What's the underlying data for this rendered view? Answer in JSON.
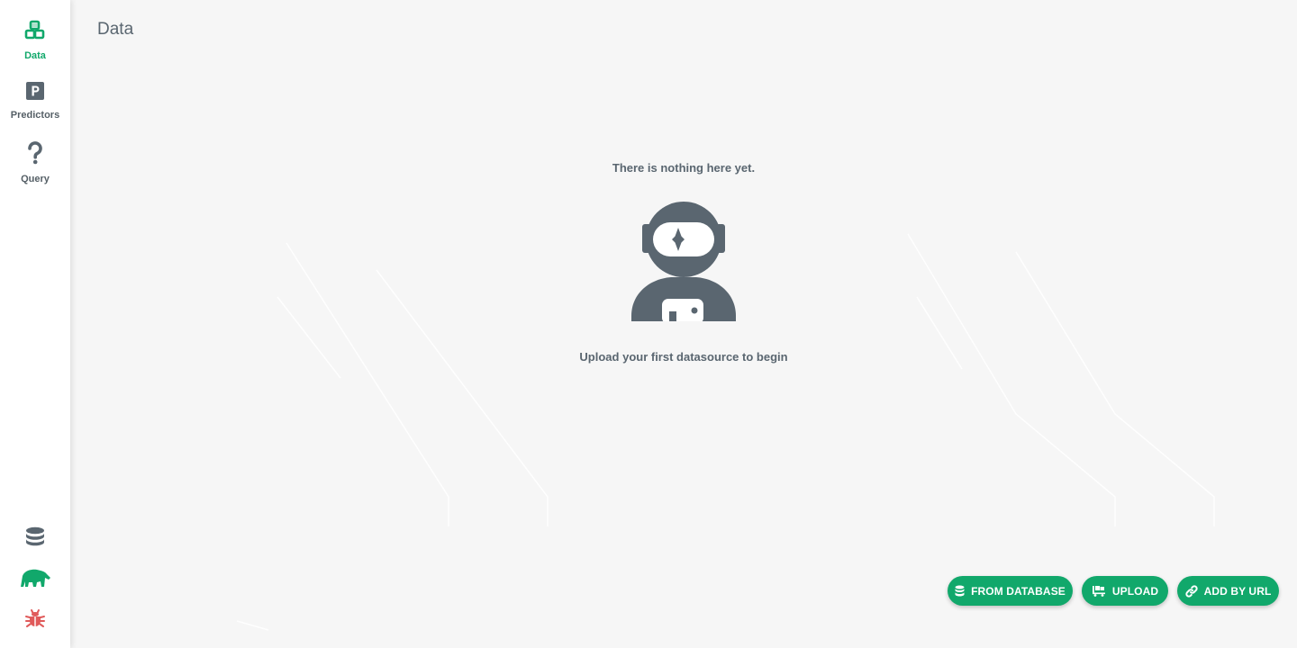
{
  "sidebar": {
    "items": [
      {
        "label": "Data",
        "icon": "cubes-icon",
        "active": true
      },
      {
        "label": "Predictors",
        "icon": "predictor-p-icon",
        "active": false
      },
      {
        "label": "Query",
        "icon": "question-icon",
        "active": false
      }
    ],
    "bottom": {
      "database_icon": "database-icon",
      "logo_icon": "mindsdb-bear-logo",
      "bug_icon": "bug-icon"
    }
  },
  "page": {
    "title": "Data"
  },
  "empty_state": {
    "title": "There is nothing here yet.",
    "subtitle": "Upload your first datasource to begin",
    "illustration": "astronaut-icon"
  },
  "actions": {
    "from_database": "FROM DATABASE",
    "upload": "UPLOAD",
    "add_by_url": "ADD BY URL"
  },
  "colors": {
    "accent": "#11a86b",
    "icon_gray": "#5a6670",
    "bug": "#e05a5a",
    "background": "#f6f6f6"
  }
}
